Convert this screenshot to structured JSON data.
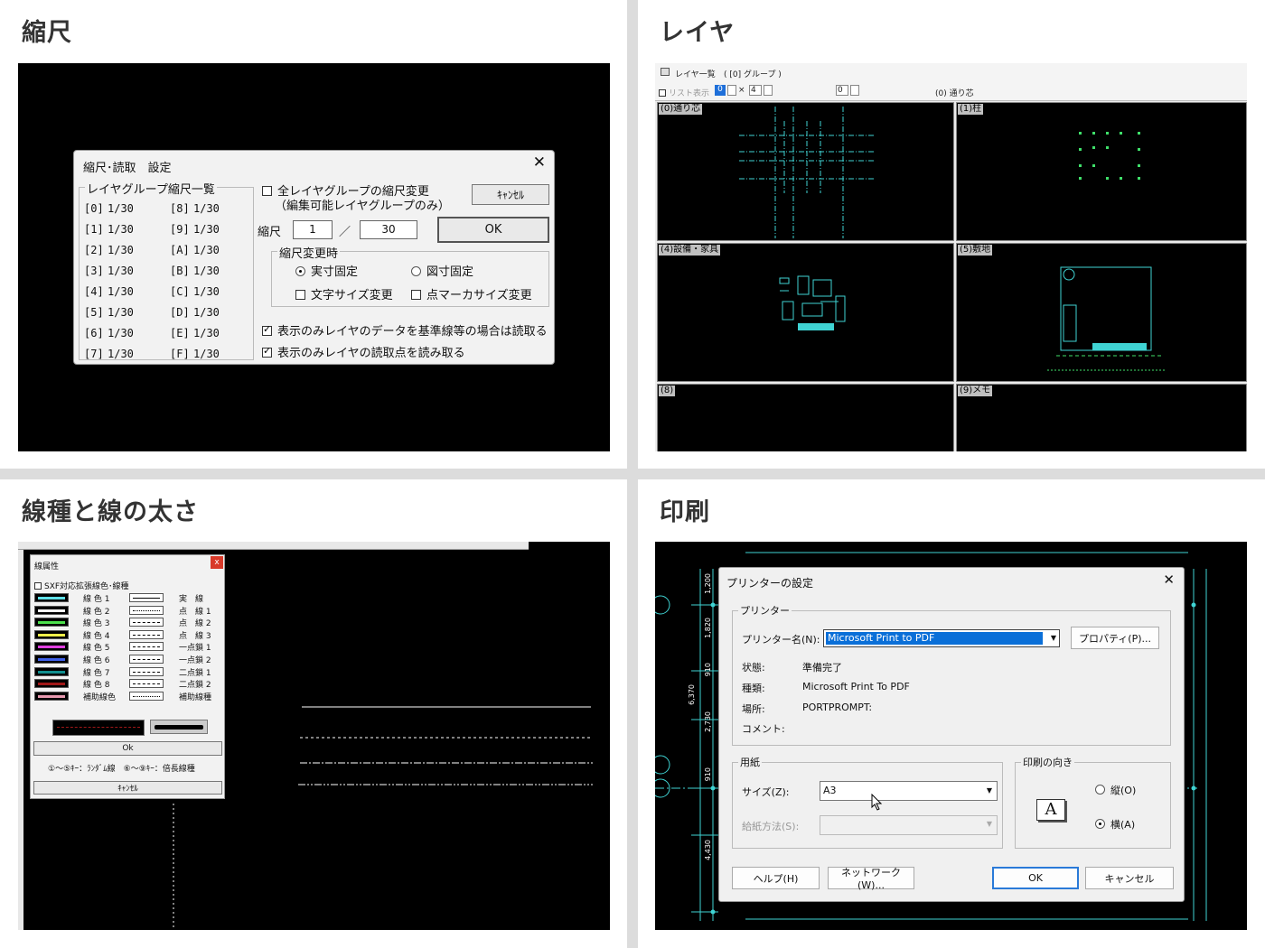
{
  "q1": {
    "title": "縮尺",
    "dialog": {
      "title": "縮尺･読取　設定",
      "group_label": "レイヤグループ縮尺一覧",
      "left_col": [
        {
          "key": "[0]",
          "val": "1/30"
        },
        {
          "key": "[1]",
          "val": "1/30"
        },
        {
          "key": "[2]",
          "val": "1/30"
        },
        {
          "key": "[3]",
          "val": "1/30"
        },
        {
          "key": "[4]",
          "val": "1/30"
        },
        {
          "key": "[5]",
          "val": "1/30"
        },
        {
          "key": "[6]",
          "val": "1/30"
        },
        {
          "key": "[7]",
          "val": "1/30"
        }
      ],
      "right_col": [
        {
          "key": "[8]",
          "val": "1/30"
        },
        {
          "key": "[9]",
          "val": "1/30"
        },
        {
          "key": "[A]",
          "val": "1/30"
        },
        {
          "key": "[B]",
          "val": "1/30"
        },
        {
          "key": "[C]",
          "val": "1/30"
        },
        {
          "key": "[D]",
          "val": "1/30"
        },
        {
          "key": "[E]",
          "val": "1/30"
        },
        {
          "key": "[F]",
          "val": "1/30"
        }
      ],
      "all_layer_change": "全レイヤグループの縮尺変更",
      "all_layer_change_sub": "（編集可能レイヤグループのみ）",
      "cancel": "ｷｬﾝｾﾙ",
      "ok": "OK",
      "scale_label": "縮尺",
      "scale_num": "1",
      "slash": "／",
      "scale_den": "30",
      "change_group": "縮尺変更時",
      "fix_actual": "実寸固定",
      "fix_drawing": "図寸固定",
      "text_size": "文字サイズ変更",
      "point_marker": "点マーカサイズ変更",
      "read_data": "表示のみレイヤのデータを基準線等の場合は読取る",
      "read_points": "表示のみレイヤの読取点を読み取る"
    }
  },
  "q2": {
    "title": "レイヤ",
    "toolbar": {
      "list_title": "レイヤ一覧",
      "group": "( [0] グループ )",
      "list_display": "リスト表示",
      "rows": "0",
      "times": "×",
      "cols": "4",
      "spin3": "0",
      "current": "(0) 通り芯"
    },
    "panels": [
      "(0)通り芯",
      "(1)柱",
      "(4)設備・家具",
      "(5)敷地",
      "(8)",
      "(9)メモ"
    ]
  },
  "q3": {
    "title": "線種と線の太さ",
    "dialog": {
      "title": "線属性",
      "sxf": "SXF対応拡張線色･線種",
      "colors": [
        "線 色 1",
        "線 色 2",
        "線 色 3",
        "線 色 4",
        "線 色 5",
        "線 色 6",
        "線 色 7",
        "線 色 8",
        "補助線色"
      ],
      "types": [
        "実　線",
        "点　線 1",
        "点　線 2",
        "点　線 3",
        "一点鎖 1",
        "一点鎖 2",
        "二点鎖 1",
        "二点鎖 2",
        "補助線種"
      ],
      "ok": "Ok",
      "hint": "①～⑤ｷｰ：ﾗﾝﾀﾞﾑ線　⑥～⑨ｷｰ：倍長線種",
      "cancel": "ｷｬﾝｾﾙ"
    },
    "swatch_colors": [
      "#5fe0e8",
      "#ffffff",
      "#4ce04c",
      "#f0f04a",
      "#e040e0",
      "#4060e8",
      "#108f8f",
      "#a01818",
      "#e89ab0"
    ]
  },
  "q4": {
    "title": "印刷",
    "dims_left": [
      "1,200",
      "1,820",
      "910",
      "2,730",
      "910",
      "4,430"
    ],
    "dim_total": "6,370",
    "dialog": {
      "title": "プリンターの設定",
      "close": "✕",
      "printer_group": "プリンター",
      "name_label": "プリンター名(N):",
      "name_value": "Microsoft Print to PDF",
      "properties": "プロパティ(P)...",
      "status_label": "状態:",
      "status_value": "準備完了",
      "type_label": "種類:",
      "type_value": "Microsoft Print To PDF",
      "where_label": "場所:",
      "where_value": "PORTPROMPT:",
      "comment_label": "コメント:",
      "paper_group": "用紙",
      "size_label": "サイズ(Z):",
      "size_value": "A3",
      "source_label": "給紙方法(S):",
      "orient_group": "印刷の向き",
      "portrait": "縦(O)",
      "landscape": "横(A)",
      "orient_icon": "A",
      "help": "ヘルプ(H)",
      "network": "ネットワーク(W)...",
      "ok": "OK",
      "cancel": "キャンセル"
    }
  }
}
